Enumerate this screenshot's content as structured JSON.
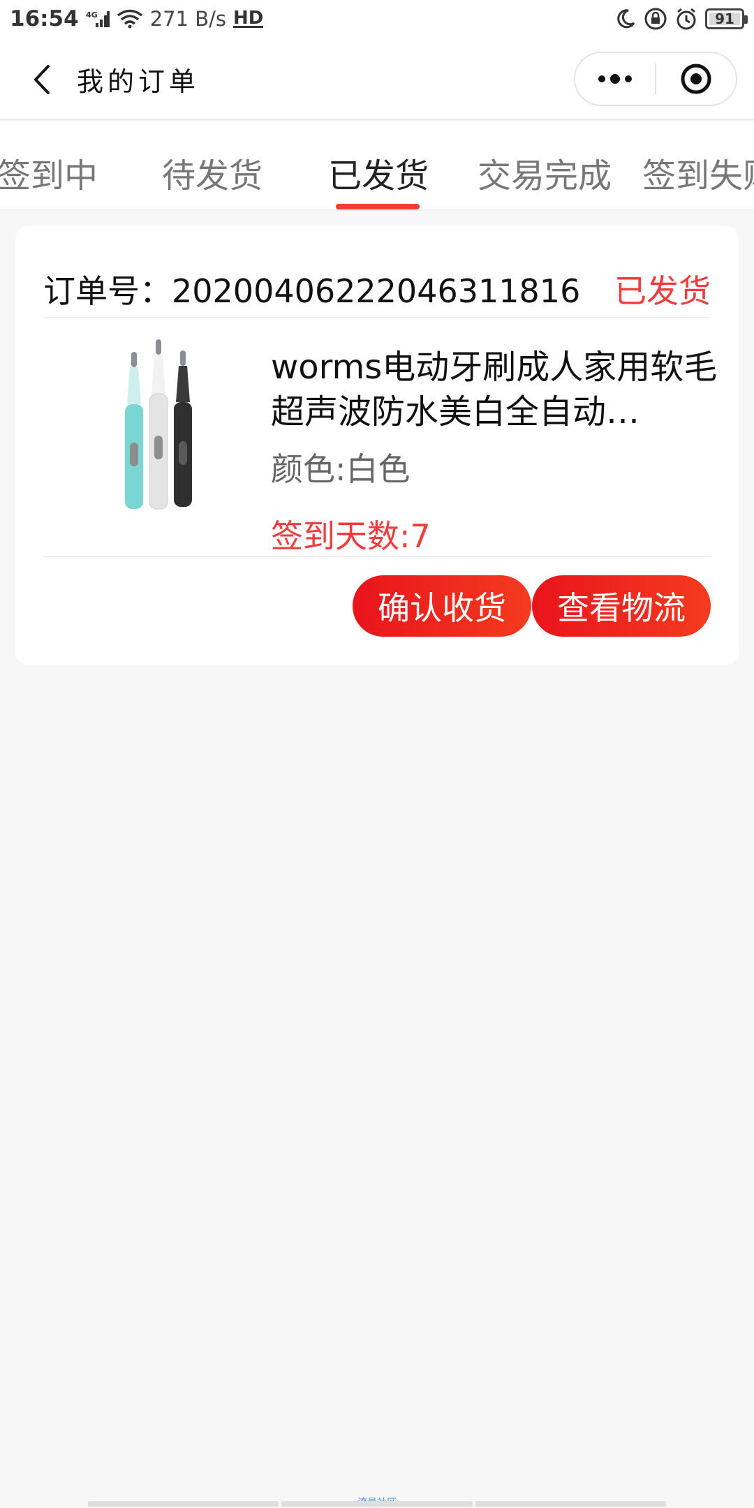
{
  "status_bar": {
    "time": "16:54",
    "network": "4G",
    "speed": "271 B/s",
    "hd": "HD",
    "battery": "91"
  },
  "nav": {
    "title": "我的订单"
  },
  "tabs": [
    {
      "label": "签到中"
    },
    {
      "label": "待发货"
    },
    {
      "label": "已发货"
    },
    {
      "label": "交易完成"
    },
    {
      "label": "签到失败"
    }
  ],
  "active_tab": "已发货",
  "order": {
    "order_no_label": "订单号：",
    "order_no": "20200406222046311816",
    "status": "已发货",
    "product_title": "worms电动牙刷成人家用软毛超声波防水美白全自动…",
    "color_label": "颜色:",
    "color_value": "白色",
    "signin_days_label": "签到天数:",
    "signin_days": "7",
    "confirm_button": "确认收货",
    "logistics_button": "查看物流"
  },
  "colors": {
    "accent": "#f23b3b",
    "button_gradient_start": "#e9141c",
    "button_gradient_end": "#f43b1f",
    "background": "#f7f7f7"
  },
  "icons": {
    "back": "chevron-left-icon",
    "more": "more-dots-icon",
    "close": "target-close-icon"
  },
  "footer_text": "流量社区"
}
